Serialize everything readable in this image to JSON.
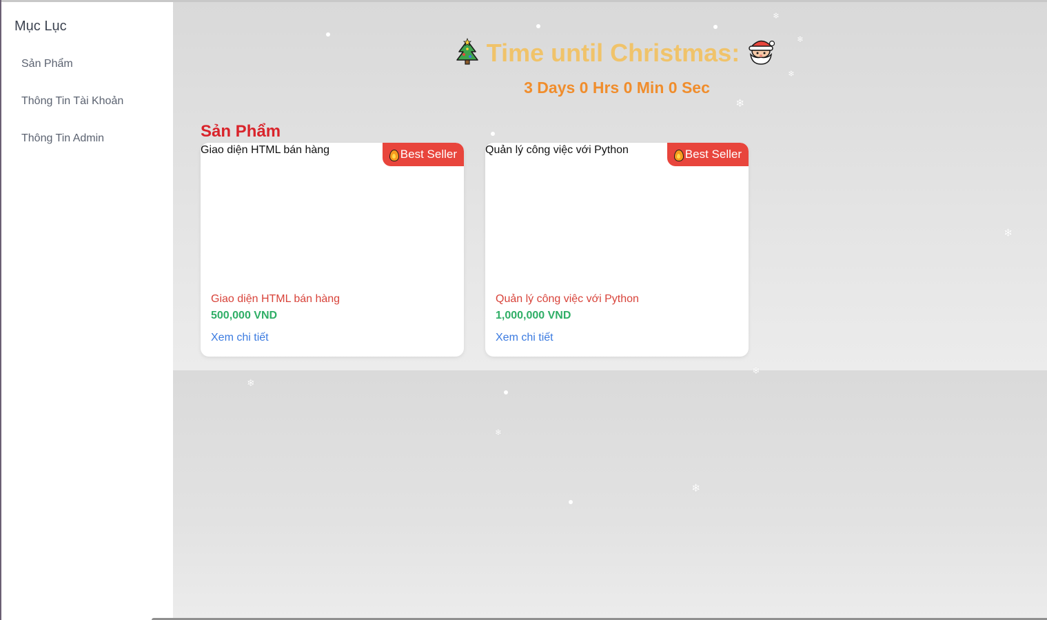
{
  "sidebar": {
    "title": "Mục Lục",
    "items": [
      {
        "label": "Sản Phẩm"
      },
      {
        "label": "Thông Tin Tài Khoản"
      },
      {
        "label": "Thông Tin Admin"
      }
    ]
  },
  "countdown": {
    "title": "Time until Christmas:",
    "left_icon": "christmas-tree-icon",
    "right_icon": "santa-icon",
    "time": "3 Days 0 Hrs 0 Min 0 Sec"
  },
  "products": {
    "heading": "Sản Phẩm",
    "items": [
      {
        "image_alt": "Giao diện HTML bán hàng",
        "badge": "Best Seller",
        "name": "Giao diện HTML bán hàng",
        "price": "500,000 VND",
        "link": "Xem chi tiết"
      },
      {
        "image_alt": "Quản lý công việc với Python",
        "badge": "Best Seller",
        "name": "Quản lý công việc với Python",
        "price": "1,000,000 VND",
        "link": "Xem chi tiết"
      }
    ]
  },
  "colors": {
    "accent_red": "#d9242b",
    "badge_red": "#e8453c",
    "price_green": "#2fae66",
    "link_blue": "#3a7ae0",
    "countdown_gold": "#f0c36a",
    "countdown_orange": "#f08d2c"
  }
}
